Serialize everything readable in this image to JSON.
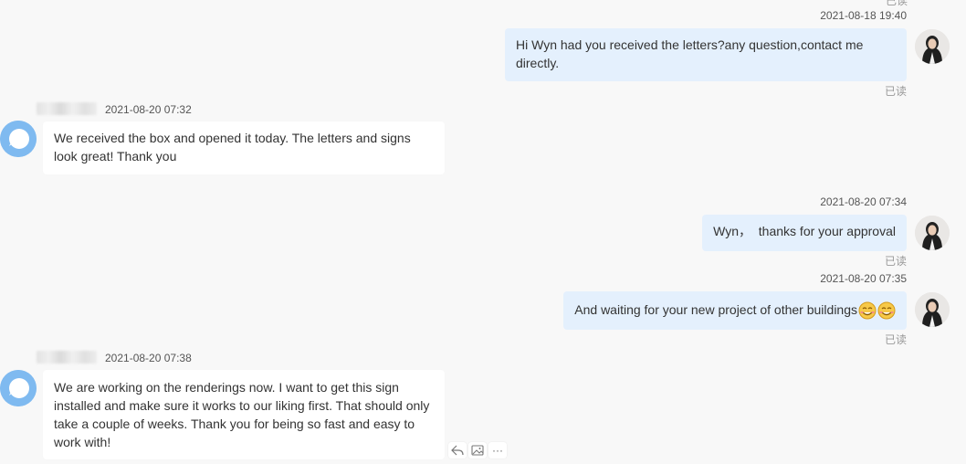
{
  "top_read_status": "已读",
  "messages": [
    {
      "direction": "out",
      "timestamp": "2021-08-18 19:40",
      "text": "Hi Wyn had you received the letters?any question,contact me directly.",
      "read_status": "已读"
    },
    {
      "direction": "in",
      "timestamp": "2021-08-20 07:32",
      "text": "We received the box and opened it today. The letters and signs look great! Thank you"
    },
    {
      "direction": "out",
      "timestamp": "2021-08-20 07:34",
      "text": "Wyn，  thanks for your approval",
      "read_status": "已读"
    },
    {
      "direction": "out",
      "timestamp": "2021-08-20 07:35",
      "text": "And waiting for your new project of other buildings",
      "emojis": [
        "smile-emoji",
        "smile-emoji"
      ],
      "read_status": "已读"
    },
    {
      "direction": "in",
      "timestamp": "2021-08-20 07:38",
      "text": "We are working on the renderings now. I want to get this sign installed and make sure it works to our liking first. That should only take a couple of weeks. Thank you for being so fast and easy to work with!"
    }
  ],
  "icons": {
    "reply": "reply-icon",
    "image": "image-icon",
    "more": "more-icon",
    "more_glyph": "···"
  },
  "colors": {
    "outgoing_bubble": "#e4f0fd",
    "incoming_bubble": "#ffffff",
    "background": "#f8f8f8",
    "bot_avatar": "#7fbaf0"
  }
}
